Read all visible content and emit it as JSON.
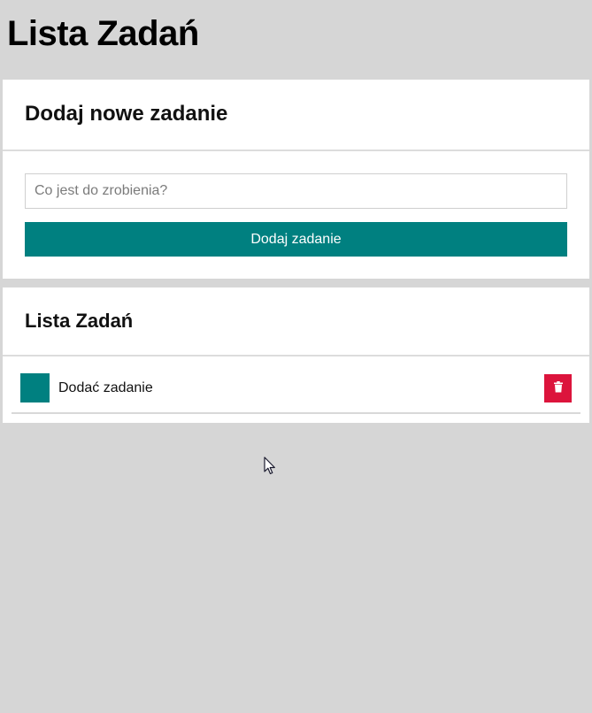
{
  "page": {
    "title": "Lista Zadań"
  },
  "add_card": {
    "title": "Dodaj nowe zadanie",
    "input_placeholder": "Co jest do zrobienia?",
    "input_value": "",
    "button_label": "Dodaj zadanie"
  },
  "list_card": {
    "title": "Lista Zadań",
    "tasks": [
      {
        "text": "Dodać zadanie",
        "delete_icon": "trash-icon"
      }
    ]
  },
  "colors": {
    "background": "#d6d6d6",
    "accent": "#008080",
    "danger": "#dc143c"
  }
}
